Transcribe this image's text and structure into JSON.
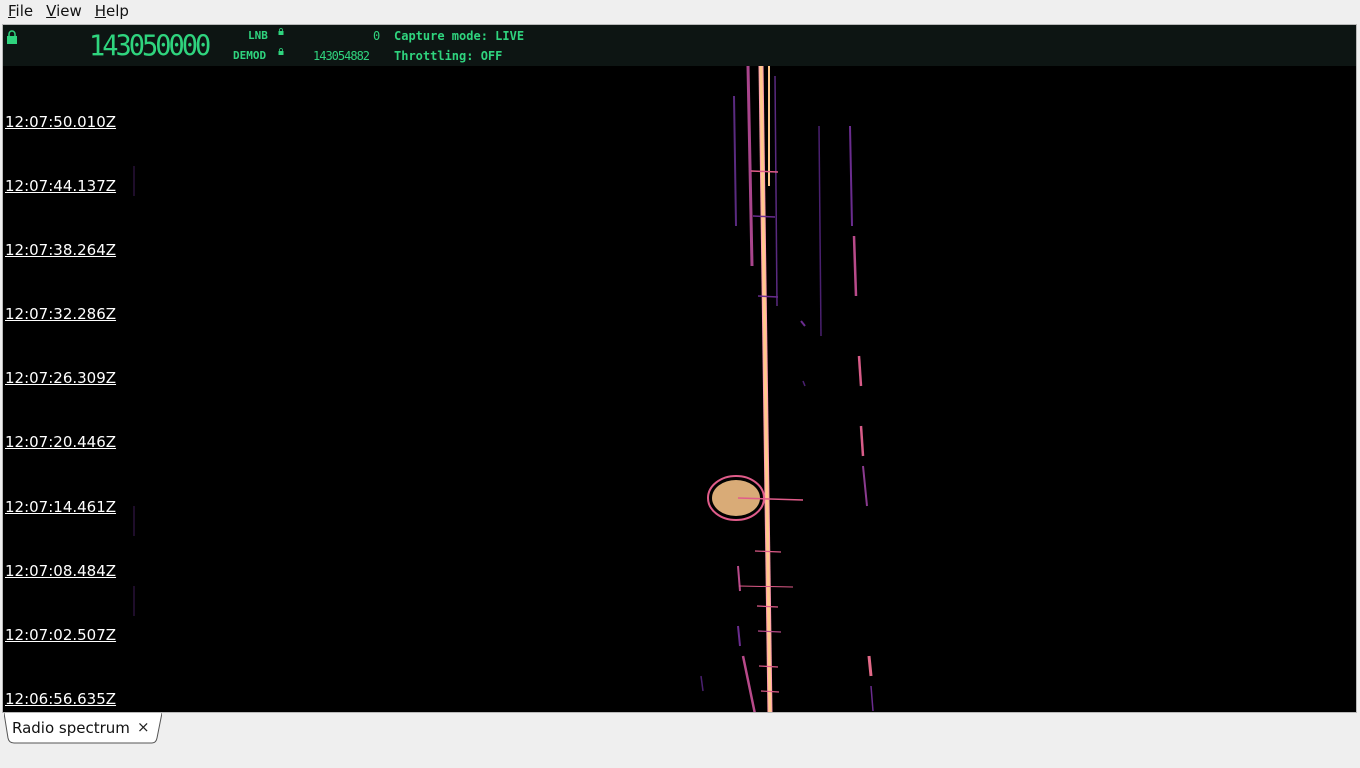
{
  "menu": {
    "file": {
      "mnemonic": "F",
      "rest": "ile"
    },
    "view": {
      "mnemonic": "V",
      "rest": "iew"
    },
    "help": {
      "mnemonic": "H",
      "rest": "elp"
    }
  },
  "header": {
    "main_frequency": "143050000",
    "lnb_label": "LNB",
    "demod_label": "DEMOD",
    "lnb_value": "0",
    "demod_value": "143054882",
    "capture_mode": "Capture mode: LIVE",
    "throttling": "Throttling: OFF",
    "text_color": "#2fd47e"
  },
  "timestamps": [
    "12:07:50.010Z",
    "12:07:44.137Z",
    "12:07:38.264Z",
    "12:07:32.286Z",
    "12:07:26.309Z",
    "12:07:20.446Z",
    "12:07:14.461Z",
    "12:07:08.484Z",
    "12:07:02.507Z",
    "12:06:56.635Z"
  ],
  "tabs": [
    {
      "label": "Radio spectrum",
      "close": "×"
    }
  ],
  "colors": {
    "waterfall_background": "#000000",
    "signal_strong": "#ffc98c",
    "signal_medium": "#e05c8a",
    "signal_weak": "#6a2c8f"
  }
}
